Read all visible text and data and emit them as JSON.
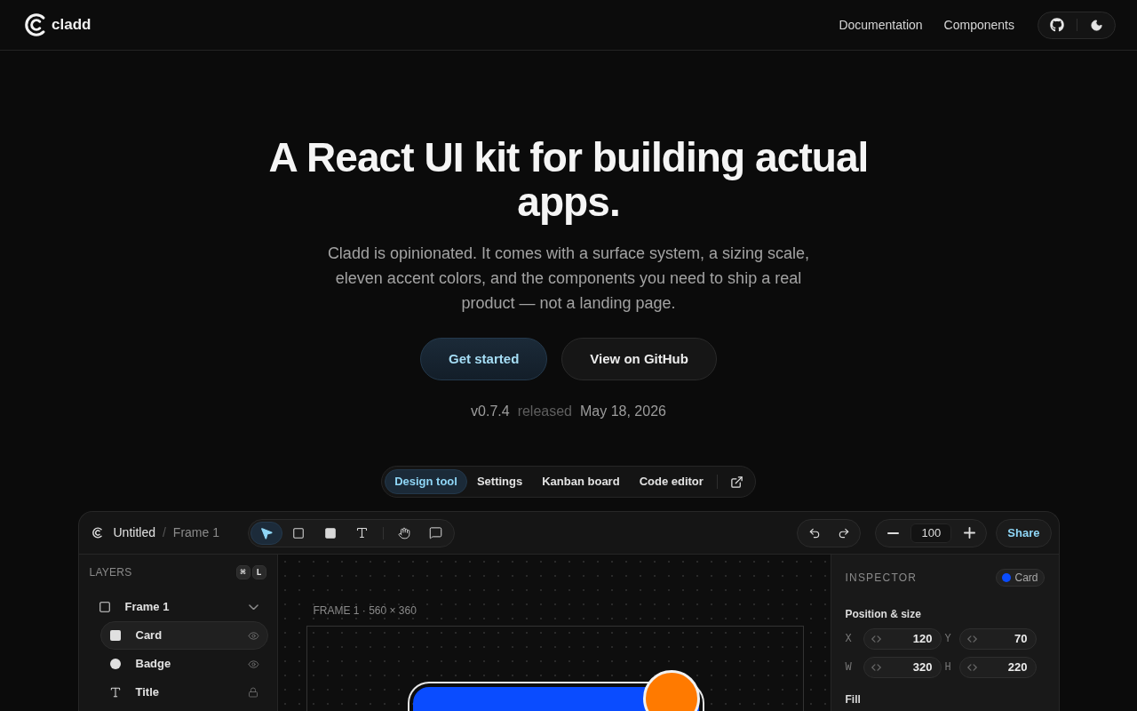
{
  "header": {
    "brand": "cladd",
    "nav": [
      "Documentation",
      "Components"
    ]
  },
  "hero": {
    "title": "A React UI kit for building actual apps.",
    "subtitle": "Cladd is opinionated. It comes with a surface system, a sizing scale, eleven accent colors, and the components you need to ship a real product — not a landing page.",
    "buttons": [
      {
        "label": "Get started",
        "kind": "primary"
      },
      {
        "label": "View on GitHub",
        "kind": "secondary"
      }
    ],
    "release": {
      "version": "v0.7.4",
      "label": "released",
      "date": "May 18, 2026"
    }
  },
  "demo_tabs": [
    {
      "label": "Design tool",
      "selected": true
    },
    {
      "label": "Settings",
      "selected": false
    },
    {
      "label": "Kanban board",
      "selected": false
    },
    {
      "label": "Code editor",
      "selected": false
    }
  ],
  "app": {
    "document": "Untitled",
    "separator": "/",
    "frame": "Frame 1",
    "tool_groups": [
      [
        {
          "kind": "pointer",
          "selected": true
        },
        {
          "kind": "frame",
          "selected": false
        },
        {
          "kind": "rectangle",
          "selected": false
        },
        {
          "kind": "text",
          "selected": false
        }
      ],
      [
        {
          "kind": "hand",
          "selected": false
        },
        {
          "kind": "comment",
          "selected": false
        }
      ]
    ],
    "zoom": "100",
    "share": "Share",
    "layers": {
      "title": "LAYERS",
      "shortcut": [
        "⌘",
        "L"
      ],
      "tree": [
        {
          "name": "Frame 1",
          "kind": "frame",
          "selected": false,
          "expanded": true,
          "children": [
            {
              "name": "Card",
              "kind": "rectangle",
              "selected": true,
              "locked": false
            },
            {
              "name": "Badge",
              "kind": "ellipse",
              "selected": false,
              "locked": false
            },
            {
              "name": "Title",
              "kind": "text",
              "selected": false,
              "locked": true
            }
          ]
        }
      ]
    },
    "canvas": {
      "frame_label": "FRAME 1 · 560 × 360",
      "shapes": [
        {
          "kind": "card",
          "color": "#0a4cff",
          "selected": true
        },
        {
          "kind": "badge",
          "color": "#ff7a00",
          "selected": false
        }
      ]
    },
    "inspector": {
      "title": "INSPECTOR",
      "selection": {
        "label": "Card",
        "color": "#0a4cff"
      },
      "section": "Position & size",
      "fields": [
        {
          "label": "X",
          "value": "120"
        },
        {
          "label": "Y",
          "value": "70"
        },
        {
          "label": "W",
          "value": "320"
        },
        {
          "label": "H",
          "value": "220"
        }
      ],
      "next_section": "Fill"
    }
  }
}
